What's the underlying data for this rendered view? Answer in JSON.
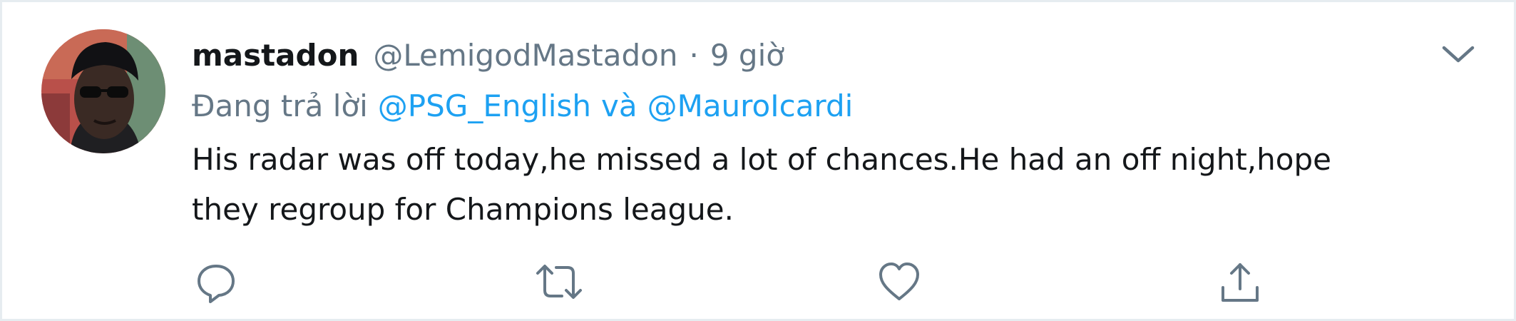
{
  "tweet": {
    "display_name": "mastadon",
    "handle": "@LemigodMastadon",
    "separator": "·",
    "time": "9 giờ",
    "reply": {
      "prefix": "Đang trả lời",
      "mention_1": "@PSG_English",
      "conjunction": "và",
      "mention_2": "@MauroIcardi"
    },
    "text_line_1": "His radar was off today,he missed a lot of chances.He had an off night,hope",
    "text_line_2": "they regroup for Champions league."
  },
  "icons": {
    "caret": "chevron-down-icon",
    "reply": "comment-icon",
    "retweet": "retweet-icon",
    "like": "heart-icon",
    "share": "share-icon"
  },
  "colors": {
    "name": "#14171a",
    "secondary": "#657786",
    "link": "#1da1f2",
    "border": "#e6ecf0"
  }
}
